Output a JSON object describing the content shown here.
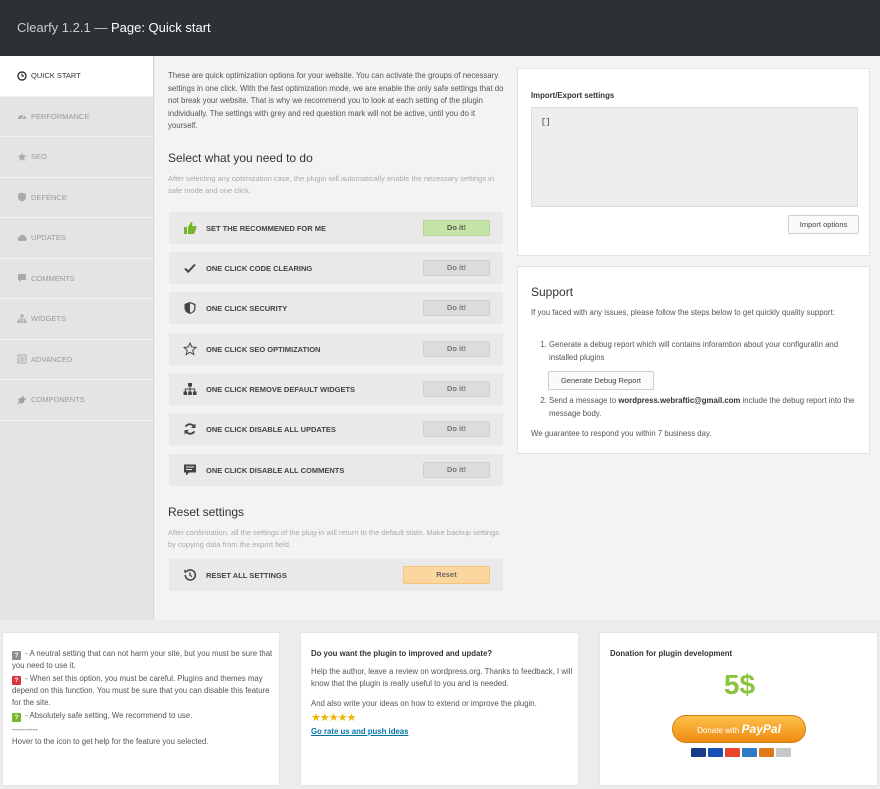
{
  "header": {
    "app": "Clearfy 1.2.1 —",
    "page": "Page: Quick start"
  },
  "sidebar": {
    "items": [
      {
        "label": "QUICK START",
        "icon": "clock-icon",
        "active": true
      },
      {
        "label": "PERFORMANCE",
        "icon": "dashboard-icon"
      },
      {
        "label": "SEO",
        "icon": "star-icon"
      },
      {
        "label": "DEFENCE",
        "icon": "shield-icon"
      },
      {
        "label": "UPDATES",
        "icon": "cloud-icon"
      },
      {
        "label": "COMMENTS",
        "icon": "comment-icon"
      },
      {
        "label": "WIDGETS",
        "icon": "sitemap-icon"
      },
      {
        "label": "ADVANCED",
        "icon": "list-icon"
      },
      {
        "label": "COMPONENTS",
        "icon": "plugin-icon"
      }
    ]
  },
  "main": {
    "intro": "These are quick optimization options for your website. You can activate the groups of necessary settings in one click. With the fast optimization mode, we are enable the only safe settings that do not break your website. That is why we recommend you to look at each setting of the plugin individually. The settings with grey and red question mark will not be active, until you do it yourself.",
    "select_title": "Select what you need to do",
    "select_desc": "After selecting any optimization case, the plugin will automatically enable the necessary settings in safe mode and one click.",
    "options": [
      {
        "label": "SET THE RECOMMENED FOR ME",
        "button": "Do it!",
        "icon": "thumbs-up-icon"
      },
      {
        "label": "ONE CLICK CODE CLEARING",
        "button": "Do it!",
        "icon": "checkmark-icon"
      },
      {
        "label": "ONE CLICK SECURITY",
        "button": "Do it!",
        "icon": "shield-icon"
      },
      {
        "label": "ONE CLICK SEO OPTIMIZATION",
        "button": "Do it!",
        "icon": "star-outline-icon"
      },
      {
        "label": "ONE CLICK REMOVE DEFAULT WIDGETS",
        "button": "Do it!",
        "icon": "sitemap-icon"
      },
      {
        "label": "ONE CLICK DISABLE ALL UPDATES",
        "button": "Do it!",
        "icon": "refresh-icon"
      },
      {
        "label": "ONE CLICK DISABLE ALL COMMENTS",
        "button": "Do it!",
        "icon": "comment-icon"
      }
    ],
    "reset_title": "Reset settings",
    "reset_desc": "After confirmation, all the settings of the plug-in will return to the default state. Make backup settings by copying data from the export field.",
    "reset_label": "RESET ALL SETTINGS",
    "reset_button": "Reset"
  },
  "import_export": {
    "title": "Import/Export settings",
    "value": "[]",
    "button": "Import options"
  },
  "support": {
    "title": "Support",
    "intro": "If you faced with any issues, please follow the steps below to get quickly quality support:",
    "step1": "Generate a debug report which will contains inforamtion about your configuratin and installed plugins",
    "debug_button": "Generate Debug Report",
    "step2_pre": "Send a message to ",
    "step2_email": "wordpress.webraftic@gmail.com",
    "step2_post": " include the debug report into the message body.",
    "footer": "We guarantee to respond you within 7 business day."
  },
  "legend": {
    "grey": " - A neutral setting that can not harm your site, but you must be sure that you need to use it.",
    "red": " - When set this option, you must be careful. Plugins and themes may depend on this function. You must be sure that you can disable this feature for the site.",
    "green": " - Absolutely safe setting, We recommend to use.",
    "sep": "----------",
    "hover": "Hover to the icon to get help for the feature you selected."
  },
  "review": {
    "title": "Do you want the plugin to improved and update?",
    "text1": "Help the author, leave a review on wordpress.org. Thanks to feedback, I will know that the plugin is really useful to you and is needed.",
    "text2": "And also write your ideas on how to extend or improve the plugin.",
    "stars": "★★★★★",
    "link": "Go rate us and push ideas"
  },
  "donation": {
    "title": "Donation for plugin development",
    "amount": "5$",
    "button_pre": "Donate with ",
    "button_brand": "PayPal"
  },
  "colors": {
    "header_bg": "#2c3136",
    "green_btn": "#c6e4a8",
    "reset_btn": "#fbd79f",
    "amount": "#8ac43f",
    "link": "#0073aa"
  }
}
